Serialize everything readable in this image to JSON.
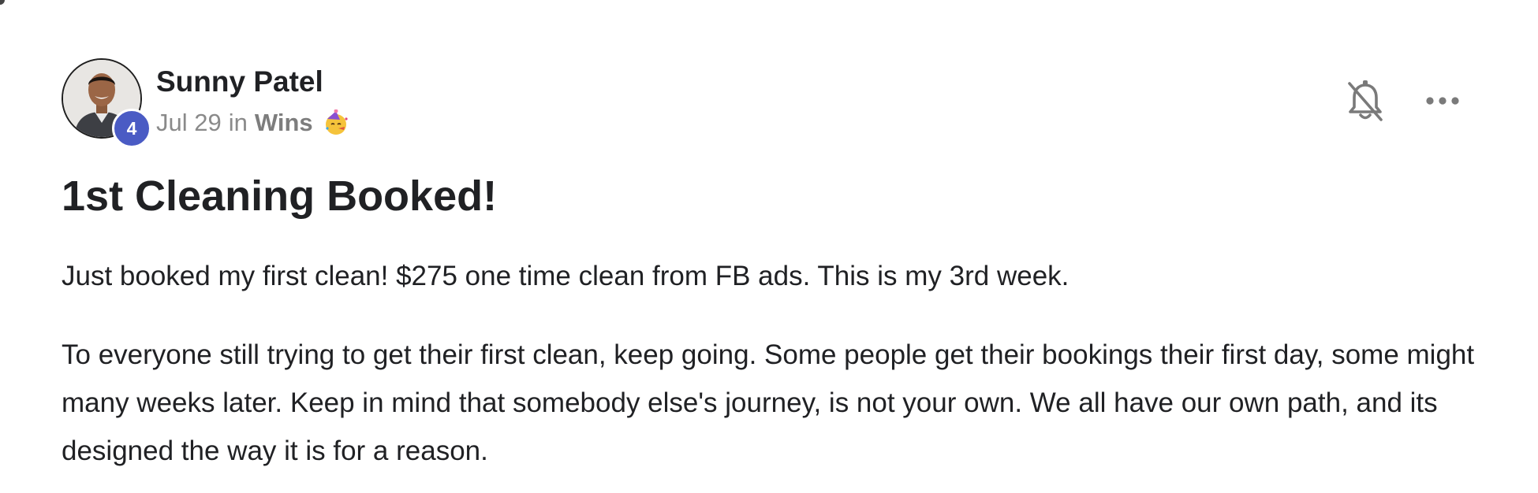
{
  "post": {
    "author": {
      "name": "Sunny Patel",
      "level": "4",
      "avatar_icon": "user-photo"
    },
    "meta": {
      "date": "Jul 29",
      "in_word": "in",
      "category": "Wins",
      "category_emoji": "party-face-icon"
    },
    "actions": {
      "bell_icon": "bell-off-icon",
      "more_icon": "more-horizontal-icon"
    },
    "title": "1st Cleaning Booked!",
    "body": {
      "paragraph_1": "Just booked my first clean! $275 one time clean from FB ads. This is my 3rd week.",
      "paragraph_2": "To everyone still trying to get their first clean, keep going. Some people get their bookings their first day, some might many weeks later. Keep in mind that somebody else's journey, is not your own. We all have our own path, and its designed the way it is for a reason."
    }
  },
  "colors": {
    "badge": "#4a5bc4",
    "text": "#202124",
    "meta": "#8a8a8a",
    "icon": "#7a7a7a"
  }
}
